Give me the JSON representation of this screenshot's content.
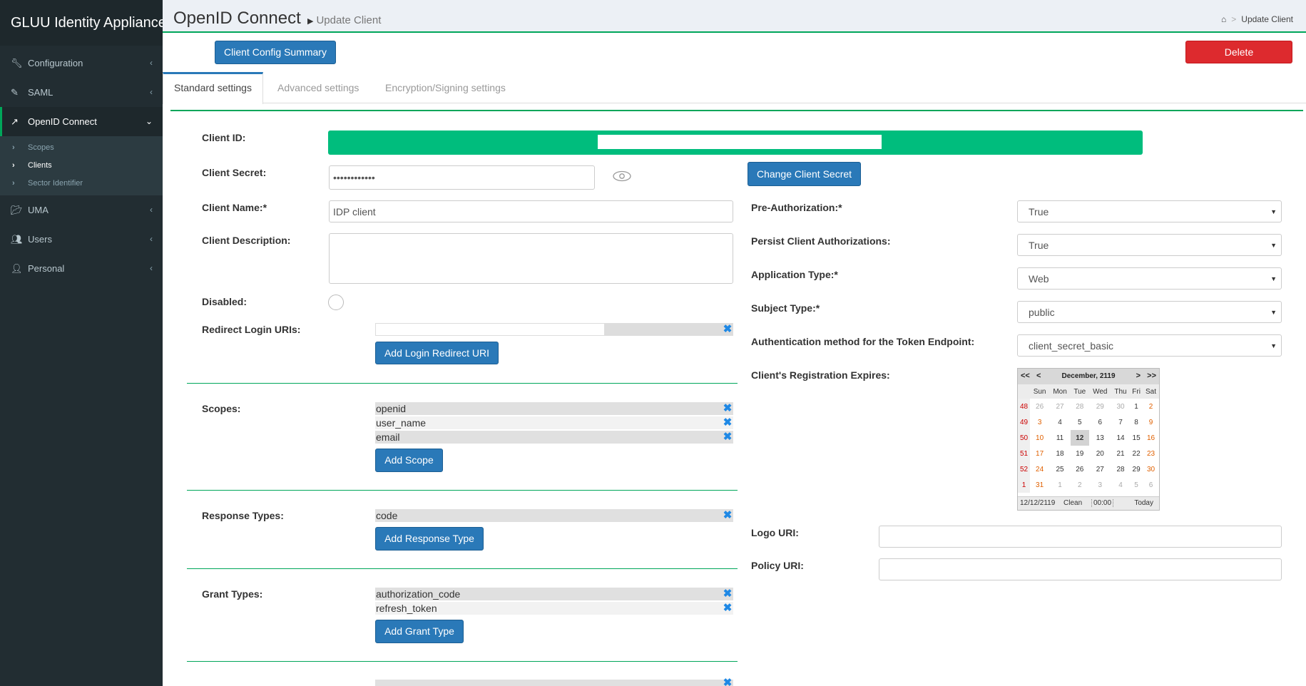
{
  "app": {
    "brand": "GLUU Identity Appliance"
  },
  "sidebar": {
    "items": [
      {
        "label": "Configuration",
        "icon": "wrench-icon"
      },
      {
        "label": "SAML",
        "icon": "edit-icon"
      },
      {
        "label": "OpenID Connect",
        "icon": "external-link-icon"
      },
      {
        "label": "UMA",
        "icon": "folder-open-icon"
      },
      {
        "label": "Users",
        "icon": "users-icon"
      },
      {
        "label": "Personal",
        "icon": "user-icon"
      }
    ],
    "submenu": [
      {
        "label": "Scopes"
      },
      {
        "label": "Clients"
      },
      {
        "label": "Sector Identifier"
      }
    ]
  },
  "header": {
    "title": "OpenID Connect",
    "subtitle": "Update Client",
    "breadcrumb": "Update Client"
  },
  "buttons": {
    "config_summary": "Client Config Summary",
    "delete": "Delete",
    "change_secret": "Change Client Secret",
    "add_login_uri": "Add Login Redirect URI",
    "add_scope": "Add Scope",
    "add_response_type": "Add Response Type",
    "add_grant_type": "Add Grant Type"
  },
  "tabs": [
    {
      "label": "Standard settings"
    },
    {
      "label": "Advanced settings"
    },
    {
      "label": "Encryption/Signing settings"
    }
  ],
  "form": {
    "client_id_label": "Client ID:",
    "client_secret_label": "Client Secret:",
    "client_secret_value": "••••••••••••",
    "client_name_label": "Client Name:*",
    "client_name_value": "IDP client",
    "client_description_label": "Client Description:",
    "disabled_label": "Disabled:",
    "redirect_label": "Redirect Login URIs:",
    "scopes_label": "Scopes:",
    "scopes": [
      "openid",
      "user_name",
      "email"
    ],
    "response_types_label": "Response Types:",
    "response_types": [
      "code"
    ],
    "grant_types_label": "Grant Types:",
    "grant_types": [
      "authorization_code",
      "refresh_token"
    ],
    "pre_auth_label": "Pre-Authorization:*",
    "pre_auth_value": "True",
    "persist_label": "Persist Client Authorizations:",
    "persist_value": "True",
    "app_type_label": "Application Type:*",
    "app_type_value": "Web",
    "subject_type_label": "Subject Type:*",
    "subject_type_value": "public",
    "auth_method_label": "Authentication method for the Token Endpoint:",
    "auth_method_value": "client_secret_basic",
    "expires_label": "Client's Registration Expires:",
    "logo_uri_label": "Logo URI:",
    "policy_uri_label": "Policy URI:"
  },
  "calendar": {
    "nav_prev_year": "<<",
    "nav_prev": "<",
    "nav_next": ">",
    "nav_next_year": ">>",
    "title": "December, 2119",
    "weekdays": [
      "Sun",
      "Mon",
      "Tue",
      "Wed",
      "Thu",
      "Fri",
      "Sat"
    ],
    "weeks": [
      {
        "wk": "48",
        "days": [
          "26",
          "27",
          "28",
          "29",
          "30",
          "1",
          "2"
        ]
      },
      {
        "wk": "49",
        "days": [
          "3",
          "4",
          "5",
          "6",
          "7",
          "8",
          "9"
        ]
      },
      {
        "wk": "50",
        "days": [
          "10",
          "11",
          "12",
          "13",
          "14",
          "15",
          "16"
        ]
      },
      {
        "wk": "51",
        "days": [
          "17",
          "18",
          "19",
          "20",
          "21",
          "22",
          "23"
        ]
      },
      {
        "wk": "52",
        "days": [
          "24",
          "25",
          "26",
          "27",
          "28",
          "29",
          "30"
        ]
      },
      {
        "wk": "1",
        "days": [
          "31",
          "1",
          "2",
          "3",
          "4",
          "5",
          "6"
        ]
      }
    ],
    "footer_date": "12/12/2119",
    "footer_clean": "Clean",
    "footer_time": "00:00",
    "footer_today": "Today"
  }
}
